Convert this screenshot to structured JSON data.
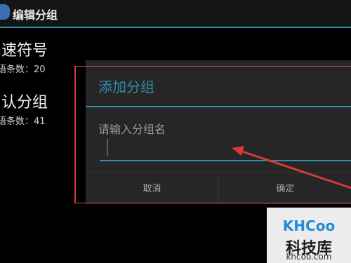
{
  "actionbar": {
    "title": "编辑分组"
  },
  "groups": [
    {
      "name": "速符号",
      "count_label": "语条数：20"
    },
    {
      "name": "认分组",
      "count_label": "语条数：41"
    }
  ],
  "dialog": {
    "title": "添加分组",
    "prompt": "请输入分组名",
    "input_value": "",
    "cancel_label": "取消",
    "confirm_label": "确定"
  },
  "watermark": {
    "logo_text": "KHCoo",
    "name": "科技库",
    "url": "khcoo.com"
  },
  "colors": {
    "accent": "#2f8fa8",
    "dialog_bg": "#262626",
    "annotation": "#d63a3a"
  },
  "icons": [
    "app-icon",
    "arrow-annotation"
  ]
}
